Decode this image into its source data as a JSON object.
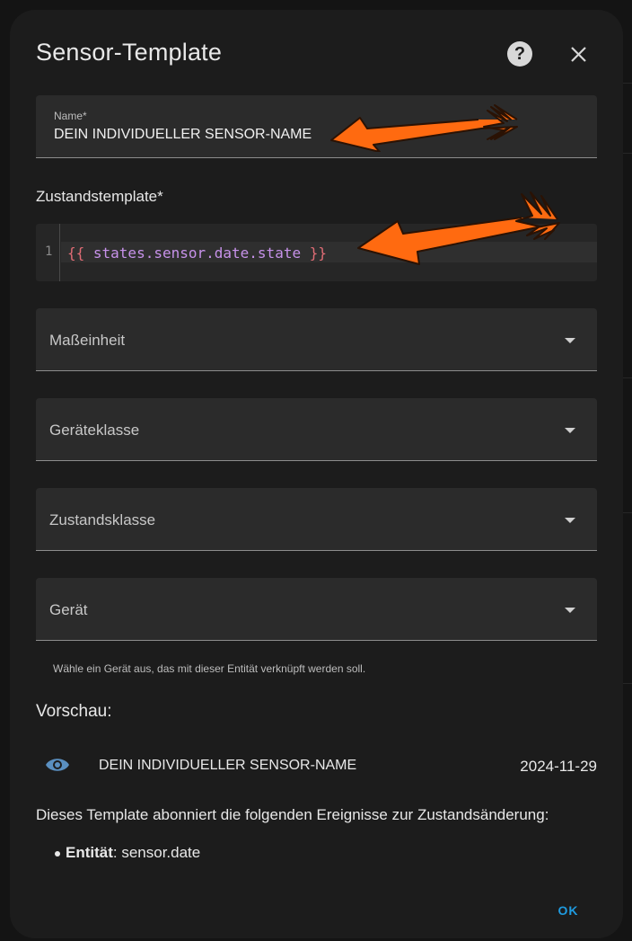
{
  "dialog": {
    "title": "Sensor-Template",
    "help_icon": "help-circle-icon",
    "close_icon": "close-icon"
  },
  "name_field": {
    "label": "Name*",
    "value": "DEIN INDIVIDUELLER SENSOR-NAME"
  },
  "state_template": {
    "label": "Zustandstemplate*",
    "line_number": "1",
    "open_brace": "{{",
    "expression": " states.sensor.date.state ",
    "close_brace": "}}"
  },
  "selects": [
    {
      "label": "Maßeinheit"
    },
    {
      "label": "Geräteklasse"
    },
    {
      "label": "Zustandsklasse"
    },
    {
      "label": "Gerät"
    }
  ],
  "device_helper": "Wähle ein Gerät aus, das mit dieser Entität verknüpft werden soll.",
  "preview": {
    "title": "Vorschau:",
    "icon": "eye-icon",
    "entity_name": "DEIN INDIVIDUELLER SENSOR-NAME",
    "state": "2024-11-29"
  },
  "subscription_info": "Dieses Template abonniert die folgenden Ereignisse zur Zustandsänderung:",
  "entities": [
    {
      "label": "Entität",
      "value": ": sensor.date"
    }
  ],
  "footer": {
    "ok_label": "OK"
  },
  "colors": {
    "dialog_bg": "#1c1c1c",
    "field_bg": "#2b2b2b",
    "accent": "#1f9be0",
    "annotation_arrow": "#ff6a10",
    "code_brace": "#e06c75",
    "code_expression": "#c792ea"
  }
}
